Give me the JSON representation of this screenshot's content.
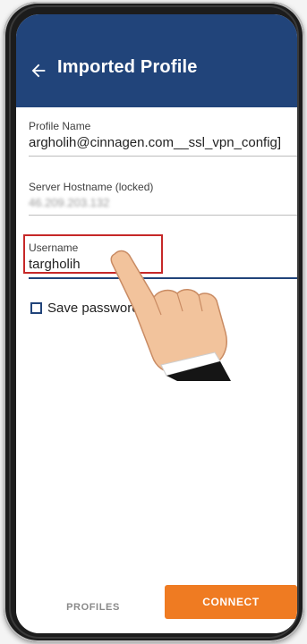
{
  "appbar": {
    "title": "Imported Profile",
    "back_icon": "back-arrow-icon",
    "color": "#21447a"
  },
  "fields": {
    "profile_name": {
      "label": "Profile Name",
      "value": "argholih@cinnagen.com__ssl_vpn_config]"
    },
    "server_hostname": {
      "label": "Server Hostname (locked)",
      "value": "46.209.203.132"
    },
    "username": {
      "label": "Username",
      "value": "targholih"
    }
  },
  "save_password": {
    "label": "Save password",
    "checked": false
  },
  "bottom_bar": {
    "profiles_label": "PROFILES",
    "connect_label": "CONNECT",
    "connect_color": "#ef7b22"
  },
  "overlay": {
    "icon": "pointing-hand-icon"
  }
}
